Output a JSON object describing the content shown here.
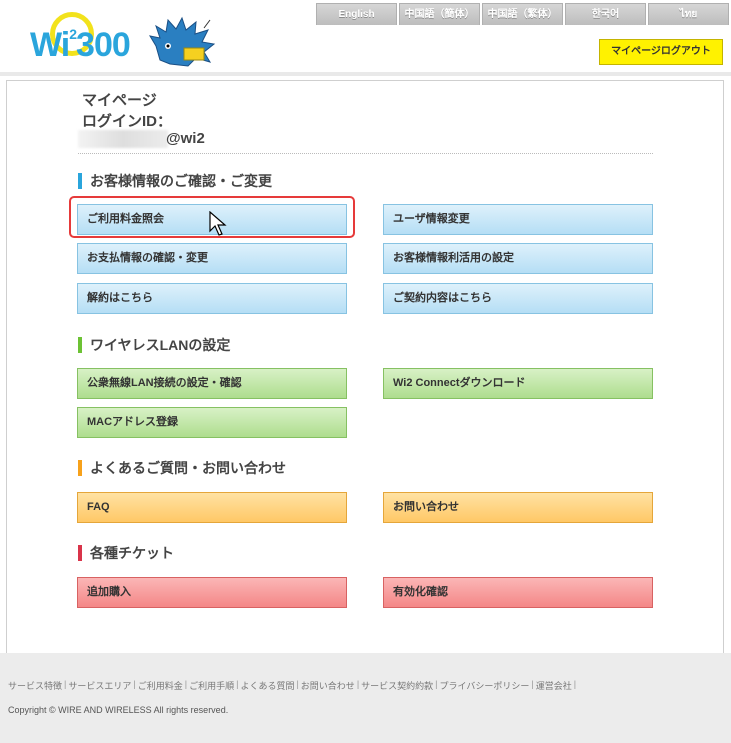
{
  "header": {
    "languages": [
      "English",
      "中国語（簡体）",
      "中国語（繁体）",
      "한국어",
      "ไทย"
    ],
    "logout_label": "マイページログアウト",
    "logo_text": "Wi2 300"
  },
  "account": {
    "mypage_title": "マイページ",
    "login_label": "ログインID：",
    "login_suffix": "@wi2"
  },
  "sections": {
    "customer": {
      "title": "お客様情報のご確認・ご変更",
      "color": "#2aa5dc",
      "buttons": [
        "ご利用料金照会",
        "ユーザ情報変更",
        "お支払情報の確認・変更",
        "お客様情報利活用の設定",
        "解約はこちら",
        "ご契約内容はこちら"
      ]
    },
    "wireless": {
      "title": "ワイヤレスLANの設定",
      "color": "#6cc234",
      "buttons": [
        "公衆無線LAN接続の設定・確認",
        "Wi2 Connectダウンロード",
        "MACアドレス登録"
      ]
    },
    "faq": {
      "title": "よくあるご質問・お問い合わせ",
      "color": "#f7a11b",
      "buttons": [
        "FAQ",
        "お問い合わせ"
      ]
    },
    "tickets": {
      "title": "各種チケット",
      "color": "#d9344a",
      "buttons": [
        "追加購入",
        "有効化確認"
      ]
    }
  },
  "footer": {
    "links": [
      "サービス特徴",
      "サービスエリア",
      "ご利用料金",
      "ご利用手順",
      "よくある質問",
      "お問い合わせ",
      "サービス契約約款",
      "プライバシーポリシー",
      "運営会社"
    ],
    "copyright": "Copyright © WIRE AND WIRELESS All rights reserved."
  }
}
